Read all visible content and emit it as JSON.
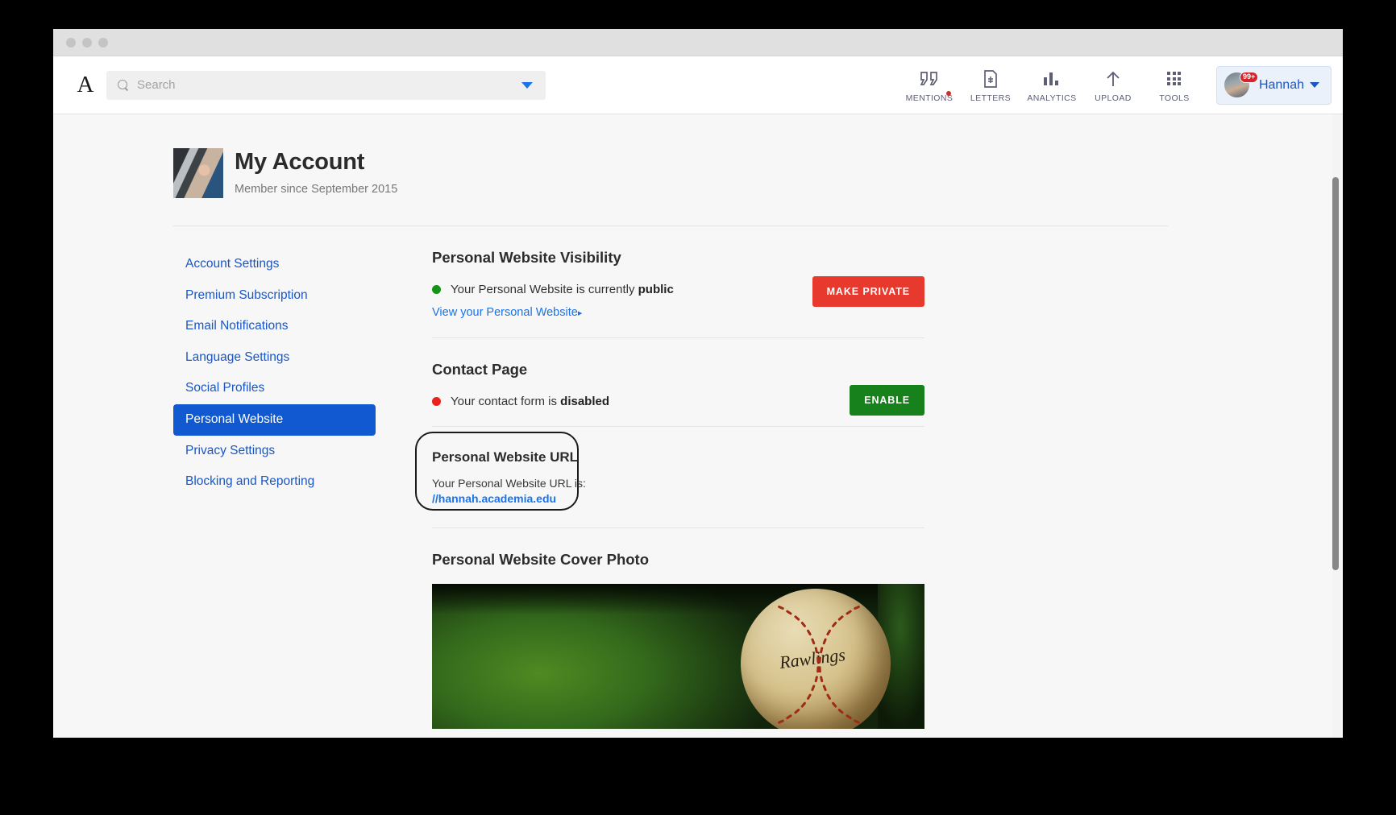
{
  "window": {
    "traffic_lights": [
      "close",
      "minimize",
      "maximize"
    ]
  },
  "topnav": {
    "logo": "A",
    "search": {
      "placeholder": "Search",
      "value": "",
      "icon": "search-icon",
      "caret_icon": "chevron-down-icon"
    },
    "items": [
      {
        "label": "MENTIONS",
        "icon": "quote-icon",
        "has_notification_dot": true
      },
      {
        "label": "LETTERS",
        "icon": "letter-doc-icon",
        "has_notification_dot": false
      },
      {
        "label": "ANALYTICS",
        "icon": "bar-chart-icon",
        "has_notification_dot": false
      },
      {
        "label": "UPLOAD",
        "icon": "upload-arrow-icon",
        "has_notification_dot": false
      },
      {
        "label": "TOOLS",
        "icon": "grid-apps-icon",
        "has_notification_dot": false
      }
    ],
    "user": {
      "name": "Hannah",
      "badge_count": "99+",
      "avatar": "user-avatar",
      "chevron": "chevron-down-icon"
    }
  },
  "account": {
    "title": "My Account",
    "member_since": "Member since September 2015",
    "photo": "profile-photo"
  },
  "sidebar": {
    "items": [
      {
        "label": "Account Settings",
        "active": false
      },
      {
        "label": "Premium Subscription",
        "active": false
      },
      {
        "label": "Email Notifications",
        "active": false
      },
      {
        "label": "Language Settings",
        "active": false
      },
      {
        "label": "Social Profiles",
        "active": false
      },
      {
        "label": "Personal Website",
        "active": true
      },
      {
        "label": "Privacy Settings",
        "active": false
      },
      {
        "label": "Blocking and Reporting",
        "active": false
      }
    ]
  },
  "main": {
    "visibility": {
      "title": "Personal Website Visibility",
      "status_prefix": "Your Personal Website is currently ",
      "status_value": "public",
      "status_color": "#159418",
      "link_label": "View your Personal Website",
      "link_arrow": "▸",
      "button_label": "MAKE PRIVATE",
      "button_color": "#e8392e"
    },
    "contact": {
      "title": "Contact Page",
      "status_prefix": "Your contact form is ",
      "status_value": "disabled",
      "status_color": "#e8221c",
      "button_label": "ENABLE",
      "button_color": "#17811c"
    },
    "url": {
      "title": "Personal Website URL",
      "description": "Your Personal Website URL is:",
      "value": "//hannah.academia.edu",
      "highlighted": true
    },
    "cover": {
      "title": "Personal Website Cover Photo",
      "image_alt": "baseball-on-grass-cover-photo",
      "image_text": "Rawlings"
    }
  },
  "colors": {
    "accent_blue": "#1a56c4",
    "link_blue": "#1a73e8",
    "active_nav_bg": "#1059d0",
    "page_bg": "#f7f7f7"
  }
}
